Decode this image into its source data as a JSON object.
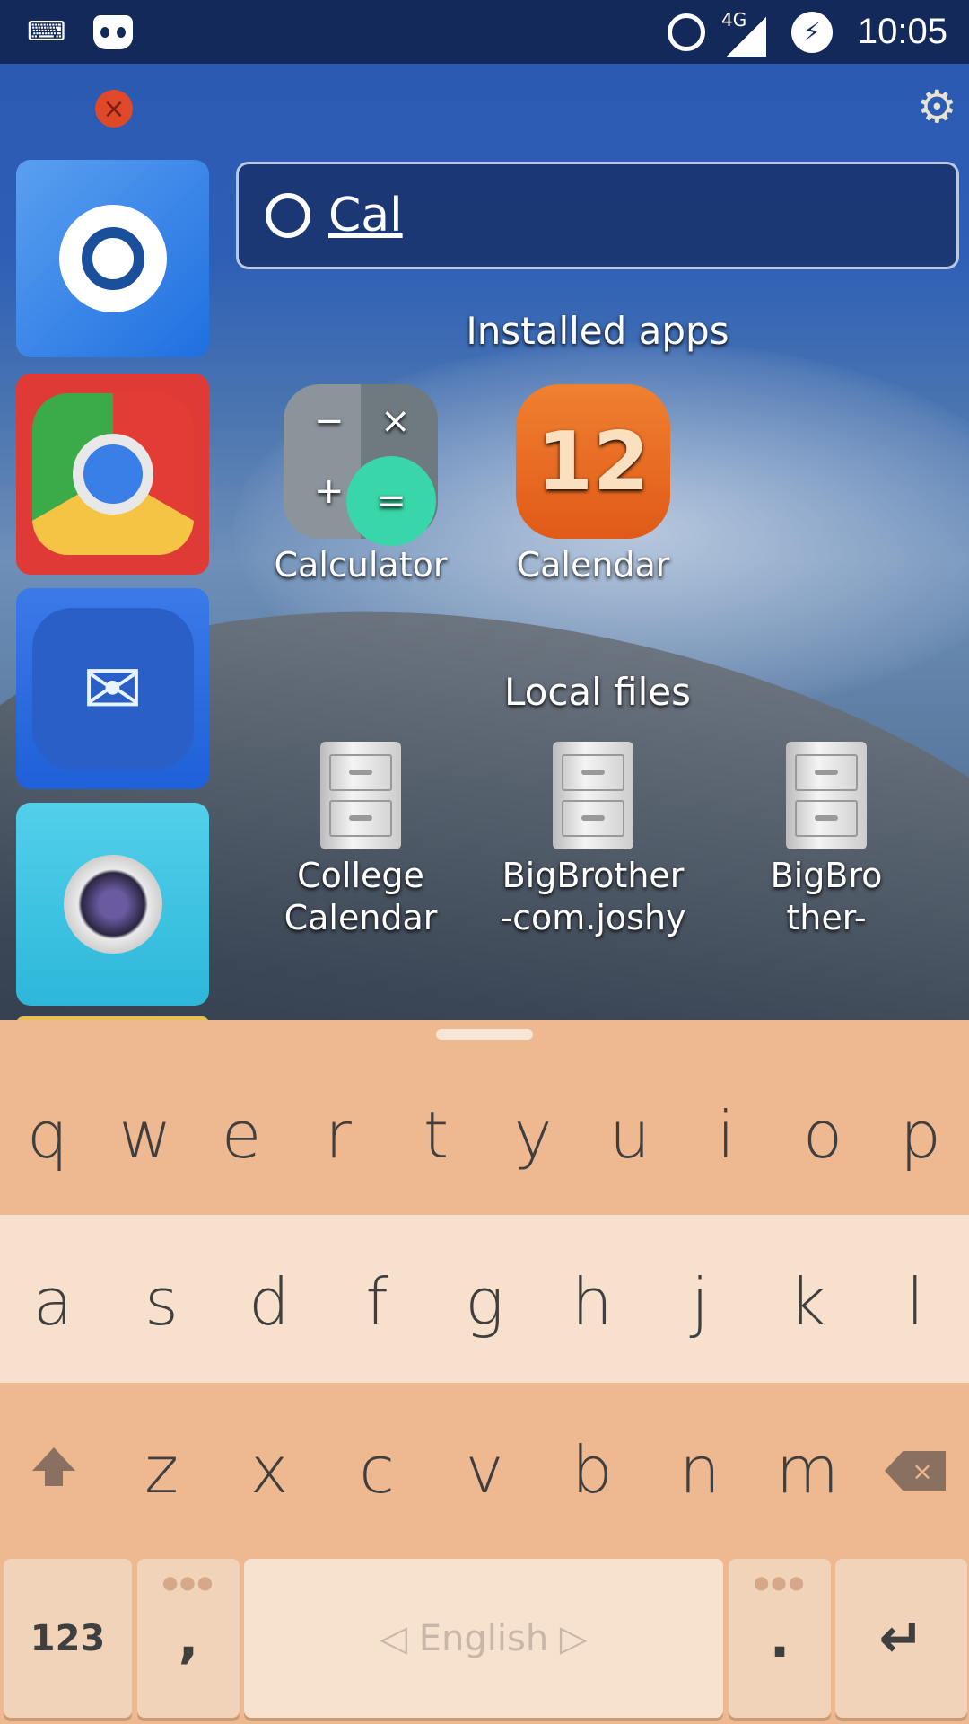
{
  "status_bar": {
    "time": "10:05",
    "network": "4G",
    "icons": [
      "keyboard-icon",
      "cyanogen-icon",
      "alarm-icon",
      "signal-icon",
      "battery-charging-icon"
    ]
  },
  "search": {
    "value": "Cal"
  },
  "sections": {
    "installed_apps": "Installed apps",
    "local_files": "Local files"
  },
  "installed_apps": [
    {
      "label": "Calculator"
    },
    {
      "label": "Calendar",
      "icon_text": "12"
    }
  ],
  "local_files": [
    {
      "line1": "College",
      "line2": "Calendar"
    },
    {
      "line1": "BigBrother",
      "line2": "-com.joshy"
    },
    {
      "line1": "BigBro",
      "line2": "ther-"
    }
  ],
  "sidebar": {
    "items": [
      "ubuntu",
      "chrome",
      "inbox",
      "camera"
    ]
  },
  "keyboard": {
    "row1": [
      "q",
      "w",
      "e",
      "r",
      "t",
      "y",
      "u",
      "i",
      "o",
      "p"
    ],
    "row2": [
      "a",
      "s",
      "d",
      "f",
      "g",
      "h",
      "j",
      "k",
      "l"
    ],
    "row3": [
      "z",
      "x",
      "c",
      "v",
      "b",
      "n",
      "m"
    ],
    "numbers": "123",
    "comma": ",",
    "space": "◁ English ▷",
    "period": ".",
    "colors": {
      "dark_row": "#eeb890",
      "light_row": "#f7e0cc"
    }
  }
}
